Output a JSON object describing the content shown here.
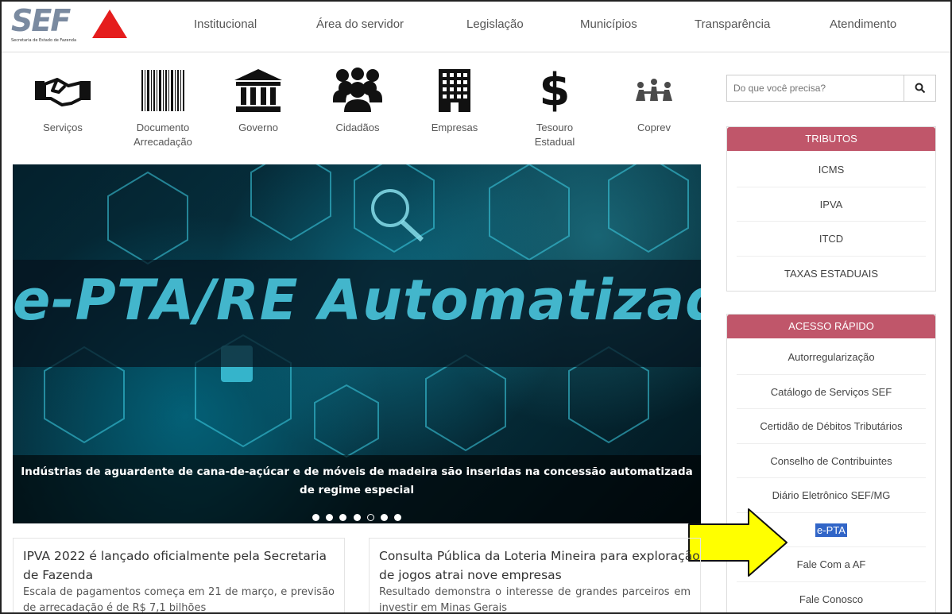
{
  "header": {
    "logo_text": "SEF",
    "logo_subtitle": "Secretaria de Estado de Fazenda",
    "nav": [
      "Institucional",
      "Área do servidor",
      "Legislação",
      "Municípios",
      "Transparência",
      "Atendimento"
    ]
  },
  "quick_icons": [
    {
      "label": "Serviços",
      "icon": "handshake-icon"
    },
    {
      "label": "Documento Arrecadação",
      "icon": "barcode-icon"
    },
    {
      "label": "Governo",
      "icon": "government-building-icon"
    },
    {
      "label": "Cidadãos",
      "icon": "people-group-icon"
    },
    {
      "label": "Empresas",
      "icon": "office-building-icon"
    },
    {
      "label": "Tesouro Estadual",
      "icon": "dollar-icon"
    },
    {
      "label": "Coprev",
      "icon": "people-network-icon"
    }
  ],
  "banner": {
    "title": "e-PTA/RE Automatizado",
    "caption": "Indústrias de aguardente de cana-de-açúcar e de móveis de madeira são inseridas na concessão automatizada de regime especial",
    "slide_count": 7,
    "active_slide": 5
  },
  "search": {
    "placeholder": "Do que você precisa?"
  },
  "tributos": {
    "title": "TRIBUTOS",
    "items": [
      "ICMS",
      "IPVA",
      "ITCD",
      "TAXAS ESTADUAIS"
    ]
  },
  "acesso_rapido": {
    "title": "ACESSO RÁPIDO",
    "items": [
      "Autorregularização",
      "Catálogo de Serviços SEF",
      "Certidão de Débitos Tributários",
      "Conselho de Contribuintes",
      "Diário Eletrônico SEF/MG",
      "e-PTA",
      "Fale Com a AF",
      "Fale Conosco"
    ],
    "selected_index": 5
  },
  "news": [
    {
      "title": "IPVA 2022 é lançado oficialmente pela Secretaria de Fazenda",
      "summary": "Escala de pagamentos começa em 21 de março, e previsão de arrecadação é de R$ 7,1 bilhões"
    },
    {
      "title": "Consulta Pública da Loteria Mineira para exploração de jogos atrai nove empresas",
      "summary": "Resultado demonstra o interesse de grandes parceiros em investir em Minas Gerais"
    }
  ],
  "colors": {
    "accent": "#c0566a",
    "logo_red": "#e51d1d",
    "highlight": "#3165c7",
    "arrow_fill": "#ffff00"
  }
}
